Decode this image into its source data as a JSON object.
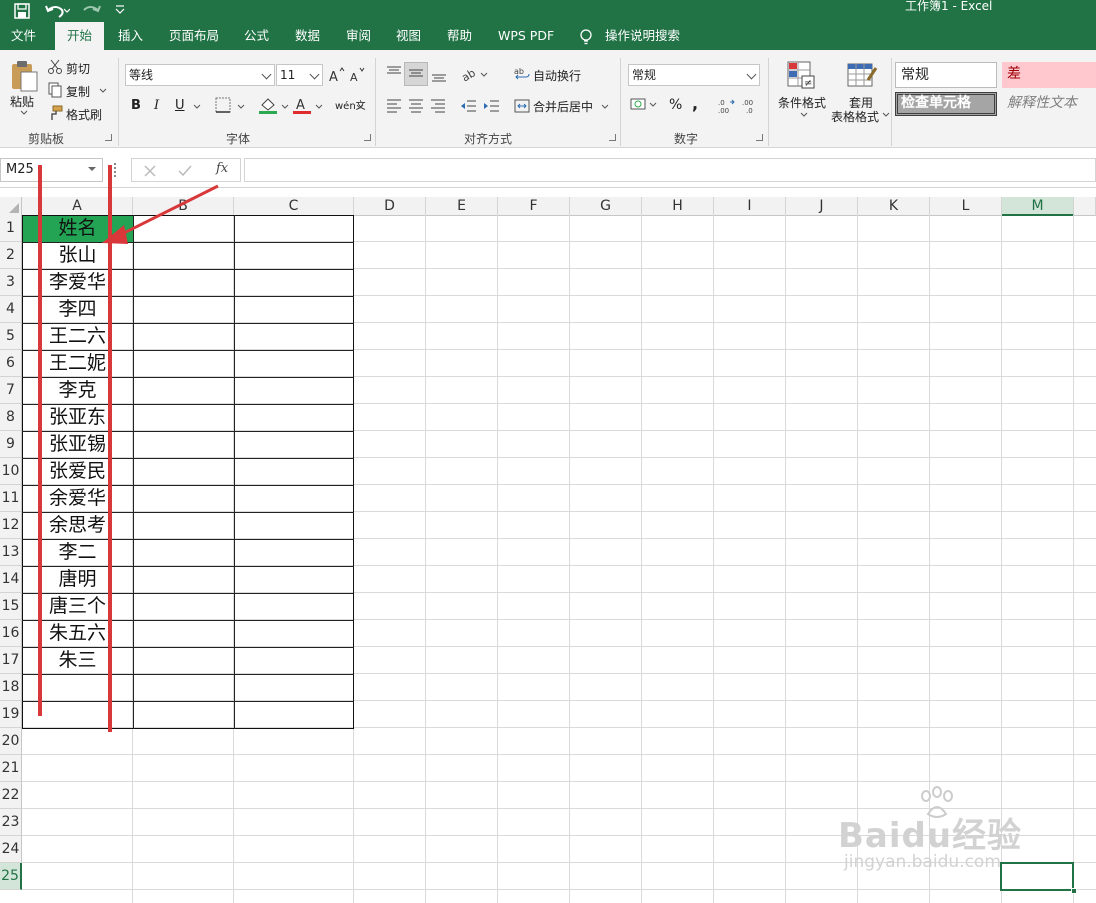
{
  "title_bar": {
    "title": "工作簿1  -  Excel"
  },
  "menu": {
    "items": [
      "文件",
      "开始",
      "插入",
      "页面布局",
      "公式",
      "数据",
      "审阅",
      "视图",
      "帮助",
      "WPS PDF"
    ],
    "search": "操作说明搜索"
  },
  "clipboard": {
    "paste": "粘贴",
    "cut": "剪切",
    "copy": "复制",
    "painter": "格式刷",
    "group": "剪贴板"
  },
  "font": {
    "name": "等线",
    "size": "11",
    "group": "字体",
    "bold": "B",
    "italic": "I",
    "underline": "U",
    "font_color_letter": "A",
    "phonetic": "wén文"
  },
  "alignment": {
    "wrap": "自动换行",
    "merge": "合并后居中",
    "group": "对齐方式"
  },
  "number": {
    "format": "常规",
    "percent": "%",
    "comma": ",",
    "group": "数字"
  },
  "styles": {
    "conditional": "条件格式",
    "table_top": "套用",
    "table_bottom": "表格格式",
    "normal": "常规",
    "bad": "差",
    "check": "检查单元格",
    "explanatory": "解释性文本"
  },
  "formula_bar": {
    "name_box": "M25",
    "fx": "fx",
    "value": ""
  },
  "columns": [
    "A",
    "B",
    "C",
    "D",
    "E",
    "F",
    "G",
    "H",
    "I",
    "J",
    "K",
    "L",
    "M"
  ],
  "rows": [
    "1",
    "2",
    "3",
    "4",
    "5",
    "6",
    "7",
    "8",
    "9",
    "10",
    "11",
    "12",
    "13",
    "14",
    "15",
    "16",
    "17",
    "18",
    "19",
    "20",
    "21",
    "22",
    "23",
    "24",
    "25"
  ],
  "cells_A": [
    "姓名",
    "张山",
    "李爱华",
    "李四",
    "王二六",
    "王二妮",
    "李克",
    "张亚东",
    "张亚锡",
    "张爱民",
    "余爱华",
    "余思考",
    "李二",
    "唐明",
    "唐三个",
    "朱五六",
    "朱三"
  ],
  "watermark": {
    "brand": "Baidu经验",
    "url": "jingyan.baidu.com"
  },
  "colors": {
    "accent": "#217346",
    "header_fill": "#22a454",
    "annotation": "#d9383a"
  }
}
